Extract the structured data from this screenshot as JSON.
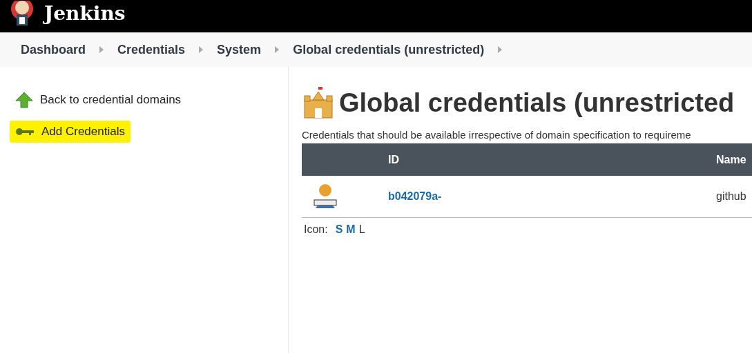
{
  "header": {
    "title": "Jenkins"
  },
  "breadcrumbs": [
    "Dashboard",
    "Credentials",
    "System",
    "Global credentials (unrestricted)"
  ],
  "sidebar": {
    "items": [
      {
        "label": "Back to credential domains",
        "kind": "back",
        "highlighted": false
      },
      {
        "label": "Add Credentials",
        "kind": "add",
        "highlighted": true
      }
    ]
  },
  "main": {
    "title": "Global credentials (unrestricted",
    "description": "Credentials that should be available irrespective of domain specification to requireme",
    "table": {
      "columns": [
        "ID",
        "Name"
      ],
      "rows": [
        {
          "id": "b042079a-",
          "name": "github"
        }
      ]
    },
    "icon_sizes": {
      "label": "Icon:",
      "options": [
        {
          "label": "S",
          "selected": false
        },
        {
          "label": "M",
          "selected": false
        },
        {
          "label": "L",
          "selected": true
        }
      ]
    }
  }
}
